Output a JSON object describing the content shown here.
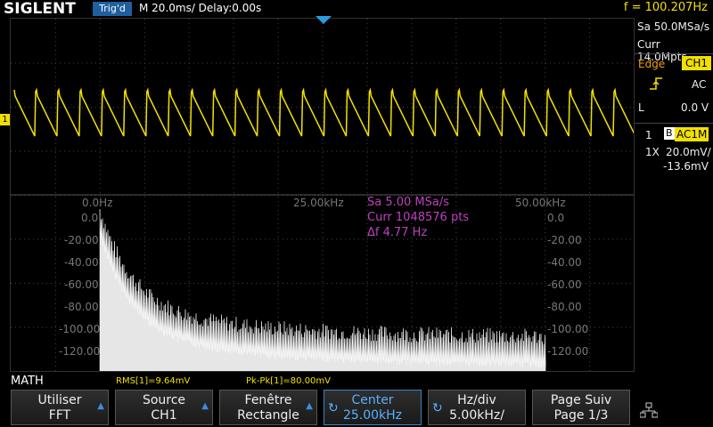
{
  "brand": "SIGLENT",
  "trigger_status": "Trig'd",
  "timebase": "M 20.0ms/ Delay:0.00s",
  "frequency": "f = 100.207Hz",
  "acquisition": {
    "sample_rate": "Sa 50.0MSa/s",
    "memory": "Curr 14.0Mpts"
  },
  "trigger": {
    "label": "Edge",
    "source": "CH1",
    "coupling": "AC",
    "level_label": "L",
    "level_value": "0.0 V"
  },
  "channel1": {
    "number": "1",
    "bw_icon": "B",
    "coupling": "AC1M",
    "probe": "1X",
    "vdiv": "20.0mV/",
    "offset": "-13.6mV",
    "marker": "1"
  },
  "fft": {
    "freq_labels": [
      "0.0Hz",
      "25.00kHz",
      "50.00kHz"
    ],
    "db_labels": [
      "0.0",
      "-20.00",
      "-40.00",
      "-60.00",
      "-80.00",
      "-100.00",
      "-120.00"
    ],
    "sample_rate": "Sa 5.00 MSa/s",
    "points": "Curr 1048576 pts",
    "resolution": "Δf 4.77 Hz"
  },
  "math_label": "MATH",
  "measurements": {
    "rms": "RMS[1]=9.64mV",
    "pkpk": "Pk-Pk[1]=80.00mV"
  },
  "softkeys": [
    {
      "line1": "Utiliser",
      "line2": "FFT"
    },
    {
      "line1": "Source",
      "line2": "CH1"
    },
    {
      "line1": "Fenêtre",
      "line2": "Rectangle"
    },
    {
      "line1": "Center",
      "line2": "25.00kHz"
    },
    {
      "line1": "Hz/div",
      "line2": "5.00kHz/"
    },
    {
      "line1": "Page Suiv",
      "line2": "Page 1/3"
    }
  ],
  "colors": {
    "ch1": "#f2e000",
    "fft": "#ffffff",
    "math_info": "#c040c0",
    "accent": "#3b82c4"
  },
  "icons": {
    "trigger_slope": "rising-edge-icon",
    "network": "network-icon"
  }
}
